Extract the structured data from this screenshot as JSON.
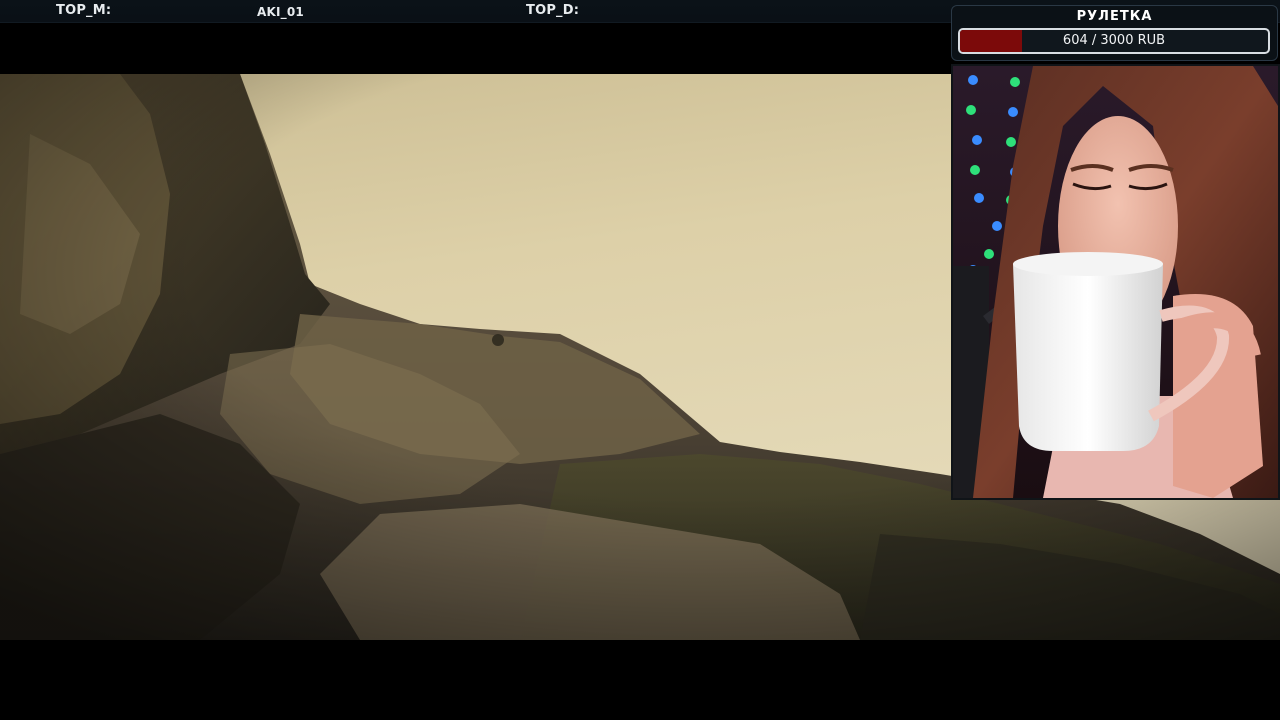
{
  "overlay": {
    "top_m_label": "TOP_M:",
    "top_m_value": "AKI_01",
    "top_d_label": "TOP_D:"
  },
  "roulette": {
    "title": "РУЛЕТКА",
    "current": 604,
    "goal": 3000,
    "progress_text": "604 / 3000 RUB",
    "progress_fraction": 0.2013,
    "fill_color": "#7c0a0a"
  },
  "video": {
    "description_icon": "video-frame"
  },
  "webcam": {
    "icon": "webcam-feed"
  }
}
